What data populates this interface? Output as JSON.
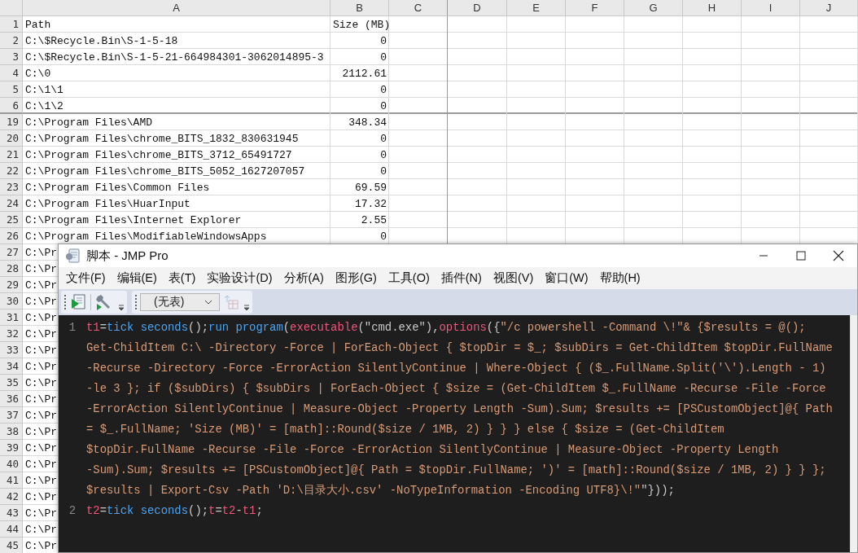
{
  "sheet": {
    "columns": [
      "A",
      "B",
      "C",
      "D",
      "E",
      "F",
      "G",
      "H",
      "I",
      "J"
    ],
    "rows": [
      {
        "number": "1",
        "cells": [
          "Path",
          "Size (MB)"
        ]
      },
      {
        "number": "2",
        "cells": [
          "C:\\$Recycle.Bin\\S-1-5-18",
          "0"
        ]
      },
      {
        "number": "3",
        "cells": [
          "C:\\$Recycle.Bin\\S-1-5-21-664984301-3062014895-3",
          "0"
        ]
      },
      {
        "number": "4",
        "cells": [
          "C:\\0",
          "2112.61"
        ]
      },
      {
        "number": "5",
        "cells": [
          "C:\\1\\1",
          "0"
        ]
      },
      {
        "number": "6",
        "cells": [
          "C:\\1\\2",
          "0"
        ]
      },
      {
        "number": "19",
        "cells": [
          "C:\\Program Files\\AMD",
          "348.34"
        ]
      },
      {
        "number": "20",
        "cells": [
          "C:\\Program Files\\chrome_BITS_1832_830631945",
          "0"
        ]
      },
      {
        "number": "21",
        "cells": [
          "C:\\Program Files\\chrome_BITS_3712_65491727",
          "0"
        ]
      },
      {
        "number": "22",
        "cells": [
          "C:\\Program Files\\chrome_BITS_5052_1627207057",
          "0"
        ]
      },
      {
        "number": "23",
        "cells": [
          "C:\\Program Files\\Common Files",
          "69.59"
        ]
      },
      {
        "number": "24",
        "cells": [
          "C:\\Program Files\\HuarInput",
          "17.32"
        ]
      },
      {
        "number": "25",
        "cells": [
          "C:\\Program Files\\Internet Explorer",
          "2.55"
        ]
      },
      {
        "number": "26",
        "cells": [
          "C:\\Program Files\\ModifiableWindowsApps",
          "0"
        ]
      },
      {
        "number": "27",
        "cells": [
          "C:\\Pr"
        ]
      },
      {
        "number": "28",
        "cells": [
          "C:\\Pr"
        ]
      },
      {
        "number": "29",
        "cells": [
          "C:\\Pr"
        ]
      },
      {
        "number": "30",
        "cells": [
          "C:\\Pr"
        ]
      },
      {
        "number": "31",
        "cells": [
          "C:\\Pr"
        ]
      },
      {
        "number": "32",
        "cells": [
          "C:\\Pr"
        ]
      },
      {
        "number": "33",
        "cells": [
          "C:\\Pr"
        ]
      },
      {
        "number": "34",
        "cells": [
          "C:\\Pr"
        ]
      },
      {
        "number": "35",
        "cells": [
          "C:\\Pr"
        ]
      },
      {
        "number": "36",
        "cells": [
          "C:\\Pr"
        ]
      },
      {
        "number": "37",
        "cells": [
          "C:\\Pr"
        ]
      },
      {
        "number": "38",
        "cells": [
          "C:\\Pr"
        ]
      },
      {
        "number": "39",
        "cells": [
          "C:\\Pr"
        ]
      },
      {
        "number": "40",
        "cells": [
          "C:\\Pr"
        ]
      },
      {
        "number": "41",
        "cells": [
          "C:\\Pr"
        ]
      },
      {
        "number": "42",
        "cells": [
          "C:\\Pr"
        ]
      },
      {
        "number": "43",
        "cells": [
          "C:\\Pr"
        ]
      },
      {
        "number": "44",
        "cells": [
          "C:\\Pr"
        ]
      },
      {
        "number": "45",
        "cells": [
          "C:\\Pr"
        ]
      }
    ]
  },
  "script_window": {
    "title": "脚本 - JMP Pro",
    "menu": [
      "文件(F)",
      "编辑(E)",
      "表(T)",
      "实验设计(D)",
      "分析(A)",
      "图形(G)",
      "工具(O)",
      "插件(N)",
      "视图(V)",
      "窗口(W)",
      "帮助(H)"
    ],
    "toolbar": {
      "table_select": "(无表)"
    },
    "lines": [
      {
        "number": "1",
        "rows": [
          {
            "tokens": [
              {
                "kind": "var",
                "text": "t1"
              },
              {
                "kind": "op",
                "text": "="
              },
              {
                "kind": "func",
                "text": "tick seconds"
              },
              {
                "kind": "op",
                "text": "();"
              },
              {
                "kind": "func",
                "text": "run program"
              },
              {
                "kind": "op",
                "text": "("
              },
              {
                "kind": "key",
                "text": "executable"
              },
              {
                "kind": "op",
                "text": "(\"cmd.exe\"),"
              },
              {
                "kind": "key",
                "text": "options"
              },
              {
                "kind": "op",
                "text": "({"
              },
              {
                "kind": "str",
                "text": "\"/c powershell -Command \\!\"& {$results = @();"
              }
            ]
          },
          {
            "tokens": [
              {
                "kind": "str",
                "text": "Get-ChildItem C:\\ -Directory -Force | ForEach-Object { $topDir = $_; $subDirs = Get-ChildItem $topDir.FullName"
              }
            ]
          },
          {
            "tokens": [
              {
                "kind": "str",
                "text": "-Recurse -Directory -Force -ErrorAction SilentlyContinue | Where-Object { ($_.FullName.Split('\\').Length - 1)"
              }
            ]
          },
          {
            "tokens": [
              {
                "kind": "str",
                "text": "-le 3 }; if ($subDirs) { $subDirs | ForEach-Object { $size = (Get-ChildItem $_.FullName -Recurse -File -Force"
              }
            ]
          },
          {
            "tokens": [
              {
                "kind": "str",
                "text": "-ErrorAction SilentlyContinue | Measure-Object -Property Length -Sum).Sum; $results += [PSCustomObject]@{ Path"
              }
            ]
          },
          {
            "tokens": [
              {
                "kind": "str",
                "text": "= $_.FullName; 'Size (MB)' = [math]::Round($size / 1MB, 2) } } } else { $size = (Get-ChildItem"
              }
            ]
          },
          {
            "tokens": [
              {
                "kind": "str",
                "text": "$topDir.FullName -Recurse -File -Force -ErrorAction SilentlyContinue | Measure-Object -Property Length"
              }
            ]
          },
          {
            "tokens": [
              {
                "kind": "str",
                "text": "-Sum).Sum; $results += [PSCustomObject]@{ Path = $topDir.FullName; ')' = [math]::Round($size / 1MB, 2) } } };"
              }
            ]
          },
          {
            "tokens": [
              {
                "kind": "str",
                "text": "$results | Export-Csv -Path 'D:\\目录大小.csv' -NoTypeInformation -Encoding UTF8}\\!\""
              },
              {
                "kind": "op",
                "text": "\"}));"
              }
            ]
          }
        ]
      },
      {
        "number": "2",
        "rows": [
          {
            "tokens": [
              {
                "kind": "var",
                "text": "t2"
              },
              {
                "kind": "op",
                "text": "="
              },
              {
                "kind": "func",
                "text": "tick seconds"
              },
              {
                "kind": "op",
                "text": "();"
              },
              {
                "kind": "var",
                "text": "t"
              },
              {
                "kind": "op",
                "text": "="
              },
              {
                "kind": "var",
                "text": "t2"
              },
              {
                "kind": "op",
                "text": "-"
              },
              {
                "kind": "var",
                "text": "t1"
              },
              {
                "kind": "op",
                "text": ";"
              }
            ]
          }
        ]
      }
    ]
  }
}
